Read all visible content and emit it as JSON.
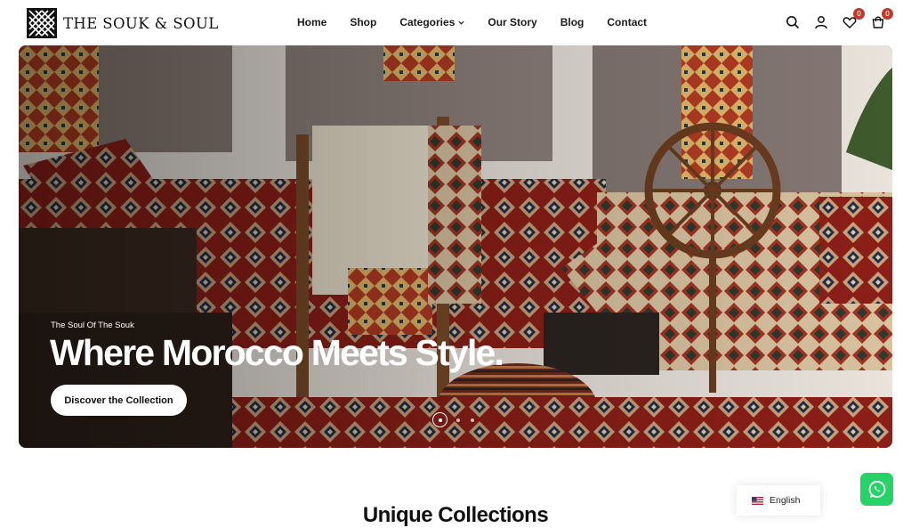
{
  "brand": {
    "name": "THE SOUK & SOUL"
  },
  "nav": {
    "items": [
      {
        "label": "Home"
      },
      {
        "label": "Shop"
      },
      {
        "label": "Categories",
        "has_dropdown": true
      },
      {
        "label": "Our Story"
      },
      {
        "label": "Blog"
      },
      {
        "label": "Contact"
      }
    ]
  },
  "header_icons": {
    "search": "search-icon",
    "account": "user-icon",
    "wishlist": {
      "icon": "heart-icon",
      "count": "0"
    },
    "cart": {
      "icon": "cart-icon",
      "count": "0"
    }
  },
  "hero": {
    "eyebrow": "The Soul Of The Souk",
    "headline": "Where Morocco Meets Style.",
    "cta_label": "Discover the Collection",
    "slides_total": 3,
    "active_slide": 1,
    "image": "moroccan-textile-showroom-photo"
  },
  "section": {
    "title": "Unique Collections"
  },
  "language": {
    "label": "English",
    "flag": "us-flag-icon"
  },
  "whatsapp": {
    "icon": "whatsapp-icon"
  },
  "colors": {
    "badge": "#c0392b",
    "whatsapp": "#25d366",
    "text": "#111111"
  }
}
